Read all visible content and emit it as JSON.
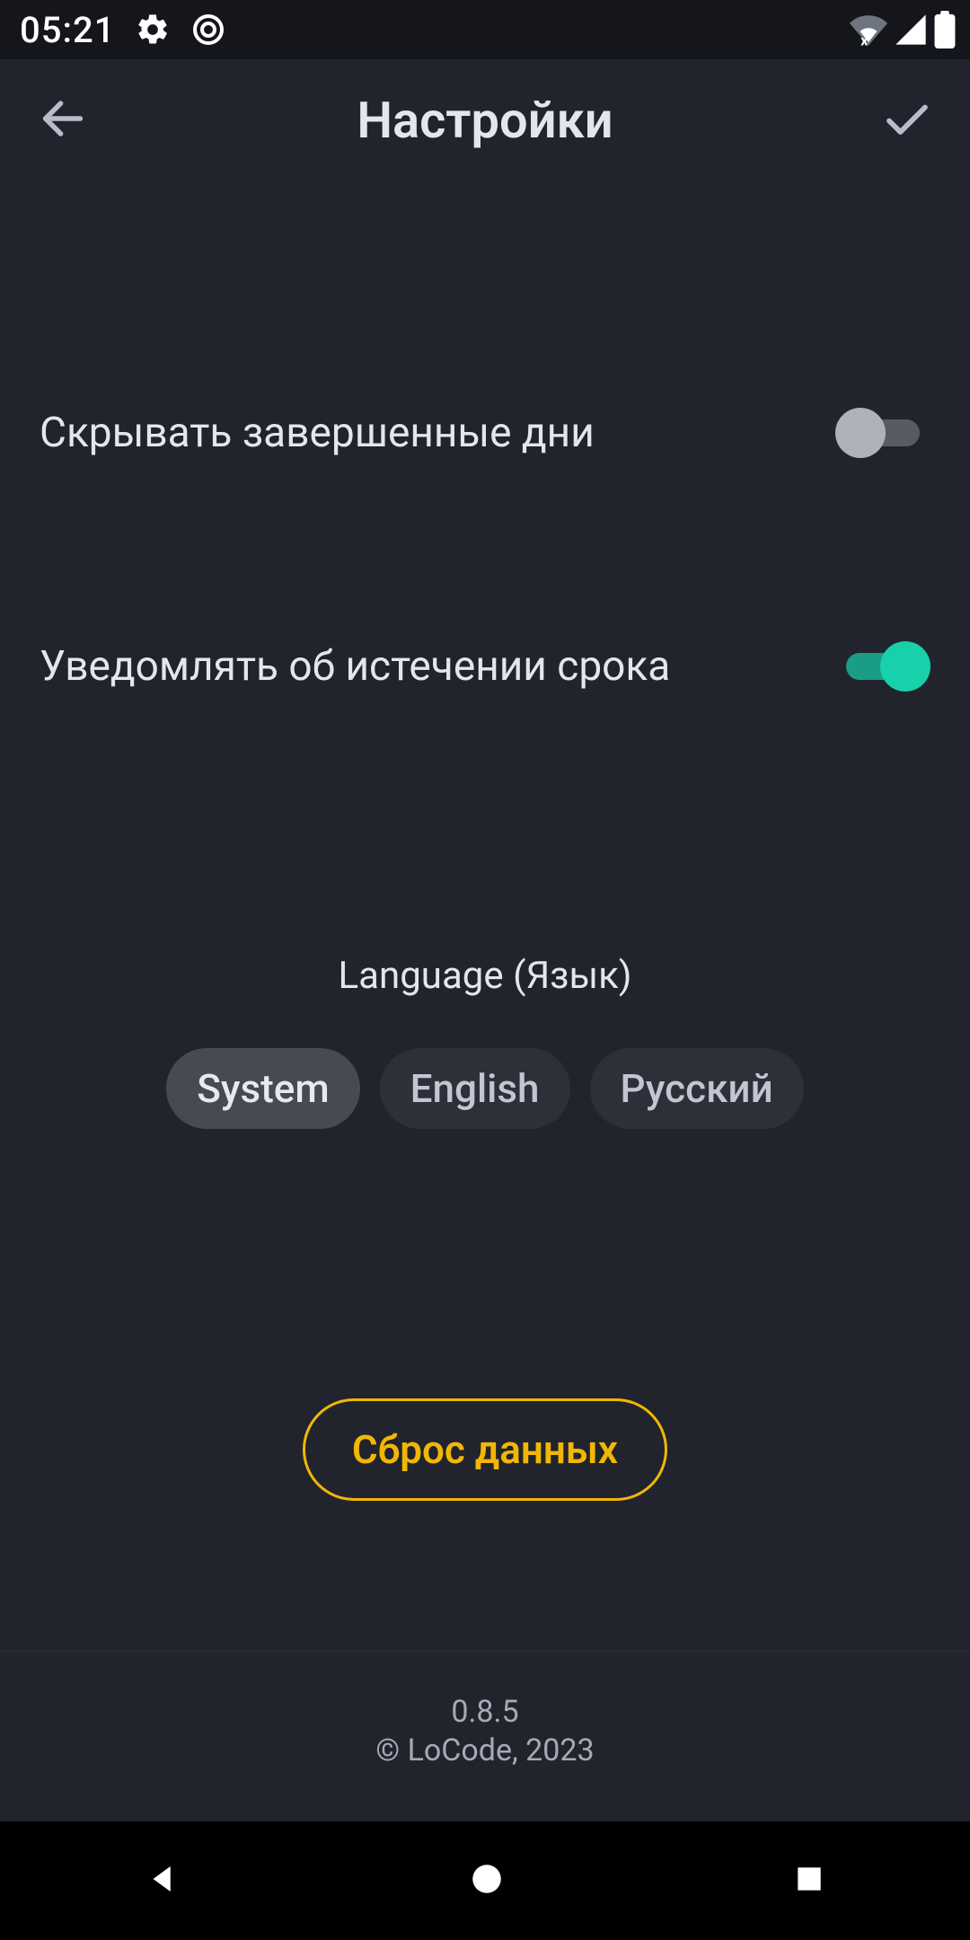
{
  "status": {
    "time": "05:21"
  },
  "appbar": {
    "title": "Настройки"
  },
  "settings": {
    "hide_completed": {
      "label": "Скрывать завершенные дни",
      "value": false
    },
    "notify_expiry": {
      "label": "Уведомлять об истечении срока",
      "value": true
    }
  },
  "language": {
    "title": "Language (Язык)",
    "options": [
      "System",
      "English",
      "Русский"
    ],
    "selected_index": 0
  },
  "reset": {
    "label": "Сброс данных"
  },
  "footer": {
    "version": "0.8.5",
    "copyright": "© LoCode, 2023"
  }
}
